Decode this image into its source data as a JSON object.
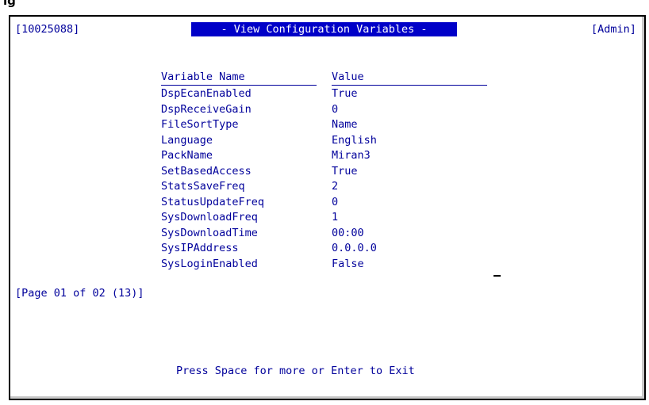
{
  "header": {
    "session_id": "[10025088]",
    "title": " - View Configuration Variables - ",
    "user_role": "[Admin]"
  },
  "table": {
    "columns": [
      "Variable Name",
      "Value"
    ],
    "rows": [
      {
        "name": "DspEcanEnabled",
        "value": "True"
      },
      {
        "name": "DspReceiveGain",
        "value": "0"
      },
      {
        "name": "FileSortType",
        "value": "Name"
      },
      {
        "name": "Language",
        "value": "English"
      },
      {
        "name": "PackName",
        "value": "Miran3"
      },
      {
        "name": "SetBasedAccess",
        "value": "True"
      },
      {
        "name": "StatsSaveFreq",
        "value": "2"
      },
      {
        "name": "StatusUpdateFreq",
        "value": "0"
      },
      {
        "name": "SysDownloadFreq",
        "value": "1"
      },
      {
        "name": "SysDownloadTime",
        "value": "00:00"
      },
      {
        "name": "SysIPAddress",
        "value": "0.0.0.0"
      },
      {
        "name": "SysLoginEnabled",
        "value": "False"
      }
    ]
  },
  "footer": {
    "page_info": "[Page 01 of 02 (13)]",
    "prompt": "Press Space for more or Enter to Exit"
  },
  "colors": {
    "text": "#00009b",
    "title_bg": "#0000c8",
    "title_fg": "#ffffff",
    "border": "#000000"
  }
}
